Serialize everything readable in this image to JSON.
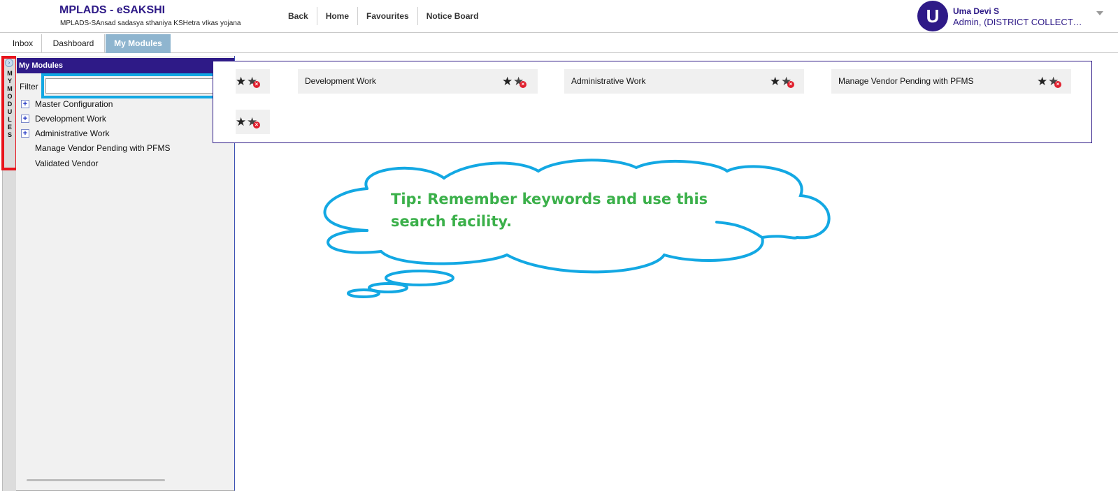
{
  "app": {
    "title": "MPLADS - eSAKSHI",
    "subtitle": "MPLADS-SAnsad sadasya sthaniya KSHetra vIkas yojana"
  },
  "top_nav": {
    "items": [
      "Back",
      "Home",
      "Favourites",
      "Notice Board"
    ]
  },
  "user": {
    "initial": "U",
    "name": "Uma Devi S",
    "role": "Admin, (DISTRICT COLLECTOR..."
  },
  "tabs": [
    {
      "label": "Inbox"
    },
    {
      "label": "Dashboard"
    },
    {
      "label": "My Modules",
      "active": true
    }
  ],
  "side_rail": {
    "label": "MY MODULES"
  },
  "modules_panel": {
    "header": "My Modules",
    "filter_label": "Filter",
    "filter_value": "",
    "tree": [
      {
        "label": "Master Configuration",
        "expandable": true
      },
      {
        "label": "Development Work",
        "expandable": true
      },
      {
        "label": "Administrative Work",
        "expandable": true
      },
      {
        "label": "Manage Vendor Pending with PFMS",
        "expandable": false
      },
      {
        "label": "Validated Vendor",
        "expandable": false
      }
    ]
  },
  "module_tiles": [
    {
      "label": ""
    },
    {
      "label": "Development Work"
    },
    {
      "label": "Administrative Work"
    },
    {
      "label": "Manage Vendor Pending with PFMS"
    },
    {
      "label": ""
    }
  ],
  "tip": {
    "text": "Tip: Remember keywords and use this search facility."
  },
  "colors": {
    "brand": "#2e1a87",
    "active_tab": "#8fb5cf",
    "highlight_red": "#e8141c",
    "highlight_blue": "#13a8e3",
    "tip_green": "#3bb04a"
  },
  "icons": [
    "expand-arrow-icon",
    "plus-toggle-icon",
    "star-icon",
    "remove-favourite-icon",
    "dropdown-caret-icon"
  ]
}
